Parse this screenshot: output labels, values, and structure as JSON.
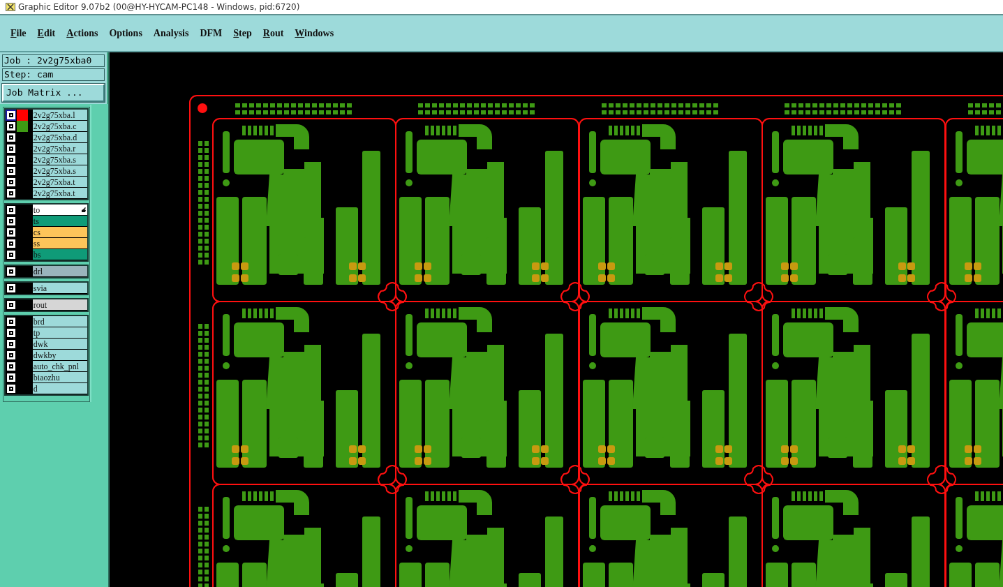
{
  "window": {
    "title": "Graphic Editor 9.07b2 (00@HY-HYCAM-PC148 - Windows, pid:6720)"
  },
  "menu": [
    {
      "label": "File",
      "mnemonic": true
    },
    {
      "label": "Edit",
      "mnemonic": true
    },
    {
      "label": "Actions",
      "mnemonic": true
    },
    {
      "label": "Options",
      "mnemonic": false
    },
    {
      "label": "Analysis",
      "mnemonic": false
    },
    {
      "label": "DFM",
      "mnemonic": false
    },
    {
      "label": "Step",
      "mnemonic": true
    },
    {
      "label": "Rout",
      "mnemonic": true
    },
    {
      "label": "Windows",
      "mnemonic": true
    }
  ],
  "job": "Job : 2v2g75xba0",
  "step": "Step: cam",
  "job_matrix_button": "Job Matrix ...",
  "layer_groups": [
    {
      "items": [
        {
          "name": "2v2g75xba.l",
          "active": true,
          "swatch": {
            "color": "#ff0000"
          },
          "color": "#9ddada",
          "pointer": false
        },
        {
          "name": "2v2g75xba.c",
          "active": false,
          "swatch": {
            "color": "#3e9a14"
          },
          "color": "#9ddada",
          "pointer": false
        },
        {
          "name": "2v2g75xba.d",
          "active": false,
          "color": "#9ddada",
          "pointer": false
        },
        {
          "name": "2v2g75xba.r",
          "active": false,
          "color": "#9ddada",
          "pointer": false
        },
        {
          "name": "2v2g75xba.s",
          "active": false,
          "color": "#9ddada",
          "pointer": false
        },
        {
          "name": "2v2g75xba.s",
          "active": false,
          "color": "#9ddada",
          "pointer": false
        },
        {
          "name": "2v2g75xba.t",
          "active": false,
          "color": "#9ddada",
          "pointer": false
        },
        {
          "name": "2v2g75xba.t",
          "active": false,
          "color": "#9ddada",
          "pointer": false
        }
      ]
    },
    {
      "items": [
        {
          "name": "to",
          "active": false,
          "color": "#ffffff",
          "pointer": true
        },
        {
          "name": "ts",
          "active": false,
          "color": "#0f9b78",
          "pointer": false
        },
        {
          "name": "cs",
          "active": false,
          "color": "#fdc55a",
          "pointer": false
        },
        {
          "name": "ss",
          "active": false,
          "color": "#fdc55a",
          "pointer": false
        },
        {
          "name": "bs",
          "active": false,
          "color": "#0f9b78",
          "pointer": false
        }
      ]
    },
    {
      "items": [
        {
          "name": "drl",
          "active": false,
          "color": "#9ab4bc",
          "pointer": false
        }
      ]
    },
    {
      "items": [
        {
          "name": "svia",
          "active": false,
          "color": "#9ddada",
          "pointer": false
        }
      ]
    },
    {
      "items": [
        {
          "name": "rout",
          "active": false,
          "color": "#d6d6d6",
          "pointer": false
        }
      ]
    },
    {
      "items": [
        {
          "name": "brd",
          "active": false,
          "color": "#9ddada",
          "pointer": false
        },
        {
          "name": "tp",
          "active": false,
          "color": "#9ddada",
          "pointer": false
        },
        {
          "name": "dwk",
          "active": false,
          "color": "#9ddada",
          "pointer": false
        },
        {
          "name": "dwkby",
          "active": false,
          "color": "#9ddada",
          "pointer": false
        },
        {
          "name": "auto_chk_pnl",
          "active": false,
          "color": "#9ddada",
          "pointer": false
        },
        {
          "name": "biaozhu",
          "active": false,
          "color": "#9ddada",
          "pointer": false
        },
        {
          "name": "d",
          "active": false,
          "color": "#9ddada",
          "pointer": false
        }
      ]
    }
  ]
}
